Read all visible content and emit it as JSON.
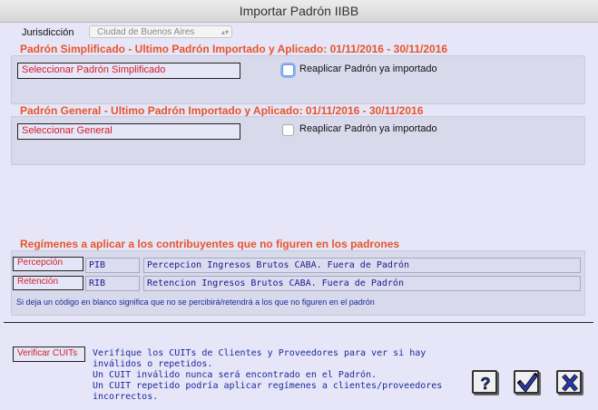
{
  "window": {
    "title": "Importar Padrón IIBB"
  },
  "jurisdiccion": {
    "label": "Jurisdicción",
    "value": "Ciudad de Buenos Aires"
  },
  "simplificado": {
    "header": "Padrón Simplificado - Ultimo Padrón Importado y Aplicado: 01/11/2016 - 30/11/2016",
    "select_label": "Seleccionar Padrón Simplificado",
    "reapply_label": "Reaplicar Padrón ya importado"
  },
  "general": {
    "header": "Padrón General - Ultimo Padrón Importado y Aplicado: 01/11/2016 - 30/11/2016",
    "select_label": "Seleccionar General",
    "reapply_label": "Reaplicar Padrón ya importado"
  },
  "regimenes": {
    "header": "Regímenes a aplicar a los contribuyentes que no figuren en los padrones",
    "rows": [
      {
        "label": "Percepción",
        "code": "PIB",
        "desc": "Percepcion Ingresos Brutos CABA. Fuera de Padrón"
      },
      {
        "label": "Retención",
        "code": "RIB",
        "desc": "Retencion Ingresos Brutos CABA. Fuera de Padrón"
      }
    ],
    "note": "Si deja un código en blanco significa que no se percibirá/retendrá a los que no figuren en el padrón"
  },
  "verificar": {
    "button_label": "Verificar CUITs",
    "text_lines": [
      "Verifique los CUITs de Clientes y Proveedores para ver si hay",
      "inválidos o repetidos.",
      "Un CUIT inválido nunca será encontrado en el Padrón.",
      "Un CUIT repetido podría aplicar regímenes a clientes/proveedores",
      "incorrectos."
    ]
  },
  "buttons": {
    "help_icon": "question-icon",
    "ok_icon": "check-icon",
    "cancel_icon": "x-icon"
  },
  "colors": {
    "header_red": "#e8542a",
    "label_red": "#d0202a",
    "text_blue": "#1a2a9a",
    "background": "#e6e6f8"
  }
}
